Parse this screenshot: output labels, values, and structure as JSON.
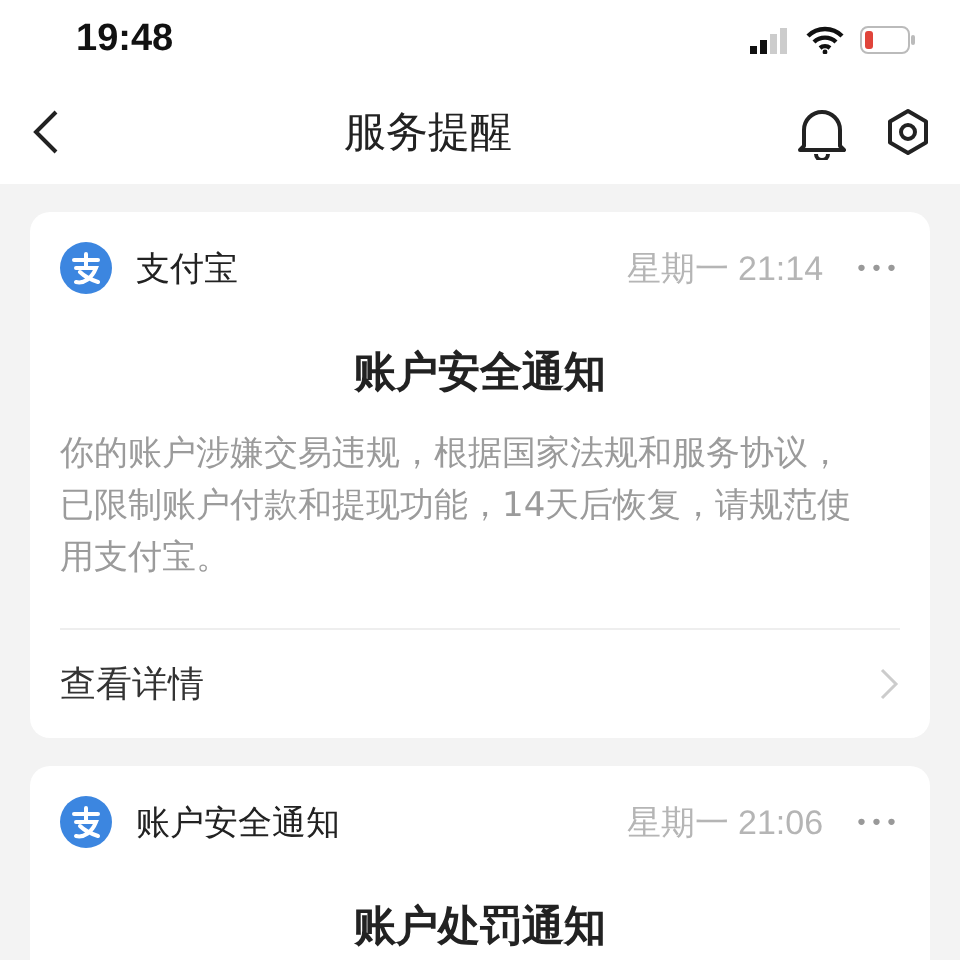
{
  "status_bar": {
    "time": "19:48"
  },
  "nav": {
    "title": "服务提醒"
  },
  "cards": [
    {
      "sender": "支付宝",
      "time": "星期一 21:14",
      "more": "•••",
      "title": "账户安全通知",
      "body": "你的账户涉嫌交易违规，根据国家法规和服务协议，已限制账户付款和提现功能，14天后恢复，请规范使用支付宝。",
      "link": "查看详情"
    },
    {
      "sender": "账户安全通知",
      "time": "星期一 21:06",
      "more": "•••",
      "title": "账户处罚通知"
    }
  ]
}
